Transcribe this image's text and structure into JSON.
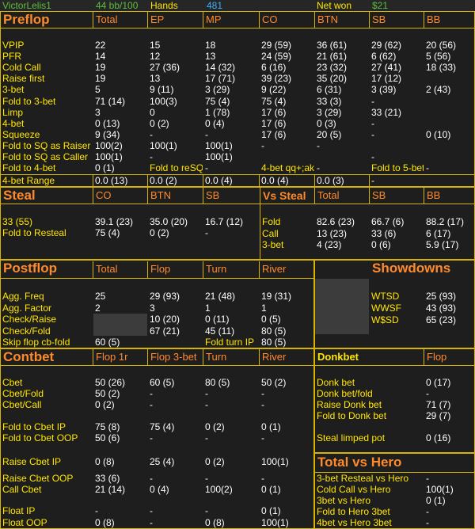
{
  "top": {
    "player": "VictorLelis1",
    "stack": "44 bb/100",
    "hands_label": "Hands",
    "hands": "481",
    "net_label": "Net won",
    "net": "$21"
  },
  "preflop": {
    "title": "Preflop",
    "cols": [
      "Total",
      "EP",
      "MP",
      "CO",
      "BTN",
      "SB",
      "BB"
    ],
    "rows": [
      [
        "VPIP",
        "22",
        "15",
        "18",
        "29 (59)",
        "36 (61)",
        "29 (62)",
        "20 (56)"
      ],
      [
        "PFR",
        "14",
        "12",
        "13",
        "24 (59)",
        "21 (61)",
        "6 (62)",
        "5 (56)"
      ],
      [
        "Cold Call",
        "19",
        "27 (36)",
        "14 (32)",
        "6 (16)",
        "23 (32)",
        "27 (41)",
        "18 (33)"
      ],
      [
        "Raise first",
        "19",
        "13",
        "17 (71)",
        "39 (23)",
        "35 (20)",
        "17 (12)",
        ""
      ],
      [
        "3-bet",
        "5",
        "9 (11)",
        "3 (29)",
        "9 (22)",
        "6 (31)",
        "3 (39)",
        "2 (43)"
      ],
      [
        "Fold to 3-bet",
        "71 (14)",
        "100(3)",
        "75 (4)",
        "75 (4)",
        "33 (3)",
        "-",
        ""
      ],
      [
        "Limp",
        "3",
        "0",
        "1 (78)",
        "17 (6)",
        "3 (29)",
        "33 (21)",
        ""
      ],
      [
        "4-bet",
        "0 (13)",
        "0 (2)",
        "0 (4)",
        "17 (6)",
        "0 (3)",
        "-",
        ""
      ],
      [
        "Squeeze",
        "9 (34)",
        "-",
        "-",
        "17 (6)",
        "20 (5)",
        "-",
        "0 (10)"
      ],
      [
        "Fold to SQ as Raiser",
        "100(2)",
        "100(1)",
        "100(1)",
        "-",
        "-",
        "",
        ""
      ],
      [
        "Fold to SQ as Caller",
        "100(1)",
        "-",
        "100(1)",
        "",
        "",
        "-",
        ""
      ]
    ],
    "fold4": {
      "label": "Fold to 4-bet",
      "val": "0 (1)",
      "resq_label": "Fold to reSQ",
      "resq_val": "-",
      "qq_label": "4-bet qq+;ak",
      "qq_val": "-",
      "f5_label": "Fold to 5-bet",
      "f5_val": "-"
    },
    "range": {
      "label": "4-bet Range",
      "v1": "0.0 (13)",
      "v2": "0.0 (2)",
      "v3": "0.0 (4)",
      "v4": "0.0 (4)",
      "v5": "0.0 (3)",
      "v6": "-"
    }
  },
  "steal": {
    "title": "Steal",
    "cols": [
      "CO",
      "BTN",
      "SB"
    ],
    "r1": [
      "33 (55)",
      "39.1 (23)",
      "35.0 (20)",
      "16.7 (12)"
    ],
    "r2": [
      "Fold to Resteal",
      "75 (4)",
      "0 (2)",
      "-"
    ]
  },
  "vs_steal": {
    "title": "Vs Steal",
    "cols": [
      "Total",
      "SB",
      "BB"
    ],
    "rows": [
      [
        "Fold",
        "82.6 (23)",
        "66.7 (6)",
        "88.2 (17)"
      ],
      [
        "Call",
        "13 (23)",
        "33 (6)",
        "6 (17)"
      ],
      [
        "3-bet",
        "4 (23)",
        "0 (6)",
        "5.9 (17)"
      ]
    ]
  },
  "postflop": {
    "title": "Postflop",
    "cols": [
      "Total",
      "Flop",
      "Turn",
      "River"
    ],
    "rows": [
      [
        "Agg. Freq",
        "25",
        "29 (93)",
        "21 (48)",
        "19 (31)"
      ],
      [
        "Agg. Factor",
        "2",
        "3",
        "1",
        "1"
      ],
      [
        "Check/Raise",
        "",
        "10 (20)",
        "0 (11)",
        "0 (5)"
      ],
      [
        "Check/Fold",
        "",
        "67 (21)",
        "45 (11)",
        "80 (5)"
      ]
    ],
    "skip": {
      "label": "Skip flop cb-fold",
      "val": "60 (5)",
      "turn_label": "Fold turn IP",
      "turn_val": "80 (5)"
    }
  },
  "showdowns": {
    "title": "Showdowns",
    "rows": [
      [
        "WTSD",
        "25 (93)"
      ],
      [
        "WWSF",
        "43 (93)"
      ],
      [
        "W$SD",
        "65 (23)"
      ]
    ]
  },
  "contbet": {
    "title": "Contbet",
    "cols": [
      "Flop 1r",
      "Flop 3-bet",
      "Turn",
      "River"
    ],
    "rows": [
      [
        "Cbet",
        "50 (26)",
        "60 (5)",
        "80 (5)",
        "50 (2)"
      ],
      [
        "Cbet/Fold",
        "50 (2)",
        "-",
        "-",
        "-"
      ],
      [
        "Cbet/Call",
        "0 (2)",
        "-",
        "-",
        "-"
      ],
      [
        "Fold to Cbet IP",
        "75 (8)",
        "75 (4)",
        "0 (2)",
        "0 (1)"
      ],
      [
        "Fold to Cbet OOP",
        "50 (6)",
        "-",
        "-",
        "-"
      ],
      [
        "Raise Cbet  IP",
        "0 (8)",
        "25 (4)",
        "0 (2)",
        "100(1)"
      ],
      [
        "Raise Cbet OOP",
        "33 (6)",
        "-",
        "-",
        "-"
      ],
      [
        "Call Cbet",
        "21 (14)",
        "0 (4)",
        "100(2)",
        "0 (1)"
      ],
      [
        "Float IP",
        "-",
        "-",
        "-",
        "0 (1)"
      ],
      [
        "Float OOP",
        "0 (8)",
        "-",
        "0 (8)",
        "100(1)"
      ]
    ]
  },
  "donkbet": {
    "title": "Donkbet",
    "col": "Flop",
    "rows": [
      [
        "Donk bet",
        "0 (17)"
      ],
      [
        "Donk bet/fold",
        "-"
      ],
      [
        "Raise Donk bet",
        "71 (7)"
      ],
      [
        "Fold to Donk bet",
        "29 (7)"
      ],
      [
        "Steal limped pot",
        "0 (16)"
      ]
    ]
  },
  "hero": {
    "title": "Total vs Hero",
    "rows": [
      [
        "3-bet Resteal vs Hero",
        "-"
      ],
      [
        "Cold Call vs Hero",
        "100(1)"
      ],
      [
        "3bet vs Hero",
        "0 (1)"
      ],
      [
        "Fold to Hero 3bet",
        "-"
      ],
      [
        "4bet vs Hero 3bet",
        "-"
      ]
    ]
  }
}
